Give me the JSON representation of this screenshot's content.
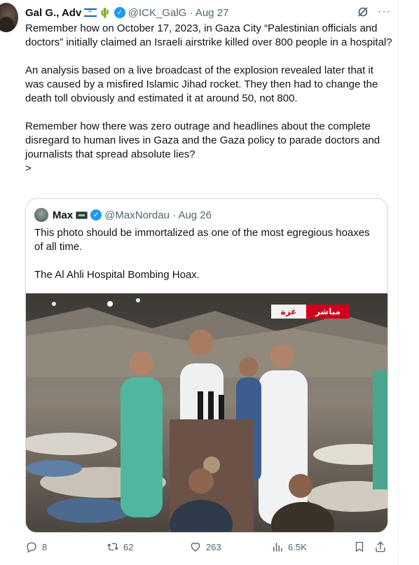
{
  "tweet": {
    "author_name": "Gal G., Adv",
    "author_emoji": "🌵",
    "handle_date": "@ICK_GalG · Aug 27",
    "more_label": "···",
    "paragraphs": [
      "Remember how on October 17, 2023, in Gaza City “Palestinian officials and doctors” initially claimed an Israeli airstrike killed over 800 people in a hospital?",
      "An analysis based on a live broadcast of the explosion revealed later that it was caused by a misfired Islamic Jihad rocket. They then had to change the death toll obviously and estimated it at around 50, not 800.",
      "Remember how there was zero outrage and headlines about the complete disregard to human lives in Gaza and the Gaza policy to parade doctors and journalists that spread absolute lies?\n>"
    ]
  },
  "quote": {
    "author_name": "Max",
    "handle_date": "@MaxNordau · Aug 26",
    "paragraphs": [
      "This photo should be immortalized as one of the most egregious hoaxes of all time.",
      "The Al Ahli Hospital Bombing Hoax."
    ],
    "photo_overlay": {
      "live_label": "مباشر",
      "location_label": "غزة"
    }
  },
  "actions": {
    "replies": "8",
    "reposts": "62",
    "likes": "263",
    "views": "6.5K"
  },
  "icons": {
    "reply": "reply-icon",
    "repost": "repost-icon",
    "like": "heart-icon",
    "views": "views-icon",
    "bookmark": "bookmark-icon",
    "share": "share-icon",
    "grok": "grok-icon",
    "verified": "verified-badge-icon"
  },
  "colors": {
    "accent": "#1d9bf0",
    "text": "#0f1419",
    "muted": "#536471",
    "live_red": "#d0021b"
  }
}
